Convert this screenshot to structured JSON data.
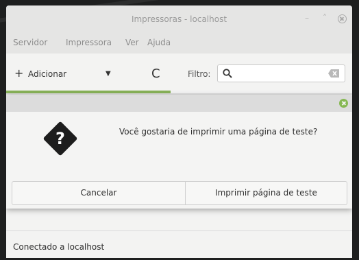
{
  "window": {
    "title": "Impressoras - localhost",
    "minimize_glyph": "–",
    "maximize_glyph": "˄"
  },
  "menubar": {
    "items": [
      "Servidor",
      "Impressora",
      "Ver",
      "Ajuda"
    ]
  },
  "toolbar": {
    "add_label": "Adicionar",
    "add_icon": "plus-icon",
    "dropdown_icon": "caret-down-icon",
    "refresh_icon": "refresh-icon",
    "filter_label": "Filtro:",
    "search": {
      "value": "",
      "icon": "search-icon",
      "clear_icon": "clear-icon"
    }
  },
  "dialog": {
    "icon": "question-icon",
    "message": "Você gostaria de imprimir uma página de teste?",
    "cancel_label": "Cancelar",
    "print_label": "Imprimir página de teste",
    "close_color": "#86b853"
  },
  "status": {
    "text": "Conectado a localhost"
  },
  "colors": {
    "accent": "#87b158",
    "window_bg": "#f3f3f2",
    "titlebar_bg": "#e5e5e4"
  }
}
